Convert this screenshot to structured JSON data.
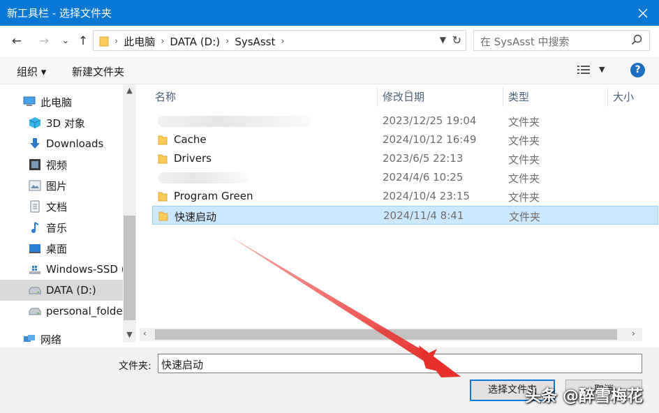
{
  "window": {
    "title": "新工具栏 - 选择文件夹"
  },
  "nav": {
    "back": "←",
    "forward": "→",
    "recent": "⌄",
    "up": "↑"
  },
  "address": {
    "crumbs": [
      "此电脑",
      "DATA (D:)",
      "SysAsst"
    ],
    "search_placeholder": "在 SysAsst 中搜索"
  },
  "toolbar": {
    "organize": "组织 ▾",
    "new_folder": "新建文件夹",
    "help": "?"
  },
  "sidebar": {
    "items": [
      {
        "label": "此电脑",
        "icon": "computer-icon"
      },
      {
        "label": "3D 对象",
        "icon": "cube-3d-icon"
      },
      {
        "label": "Downloads",
        "icon": "download-icon"
      },
      {
        "label": "视频",
        "icon": "video-icon"
      },
      {
        "label": "图片",
        "icon": "picture-icon"
      },
      {
        "label": "文档",
        "icon": "document-icon"
      },
      {
        "label": "音乐",
        "icon": "music-icon"
      },
      {
        "label": "桌面",
        "icon": "desktop-icon"
      },
      {
        "label": "Windows-SSD (",
        "icon": "drive-windows-icon"
      },
      {
        "label": "DATA (D:)",
        "icon": "drive-icon",
        "selected": true
      },
      {
        "label": "personal_folde",
        "icon": "drive-icon"
      },
      {
        "label": "网络",
        "icon": "network-icon"
      }
    ]
  },
  "columns": {
    "name": "名称",
    "date": "修改日期",
    "type": "类型",
    "size": "大小"
  },
  "files": [
    {
      "name": "",
      "date": "2023/12/25 19:04",
      "type": "文件夹",
      "blurred": true
    },
    {
      "name": "Cache",
      "date": "2024/10/12 16:49",
      "type": "文件夹"
    },
    {
      "name": "Drivers",
      "date": "2023/6/5 22:13",
      "type": "文件夹"
    },
    {
      "name": "",
      "date": "2024/4/6 10:25",
      "type": "文件夹",
      "blurred": true
    },
    {
      "name": "Program Green",
      "date": "2024/10/4 23:15",
      "type": "文件夹"
    },
    {
      "name": "快速启动",
      "date": "2024/11/4 8:41",
      "type": "文件夹",
      "selected": true
    }
  ],
  "footer": {
    "folder_label": "文件夹:",
    "folder_value": "快速启动",
    "select_button": "选择文件夹",
    "cancel_button": "取消"
  },
  "watermark": "头条 @醉雪梅花",
  "colors": {
    "title_bar": "#0a78d4",
    "selection": "#cce8ff",
    "arrow": "#e8302a"
  }
}
